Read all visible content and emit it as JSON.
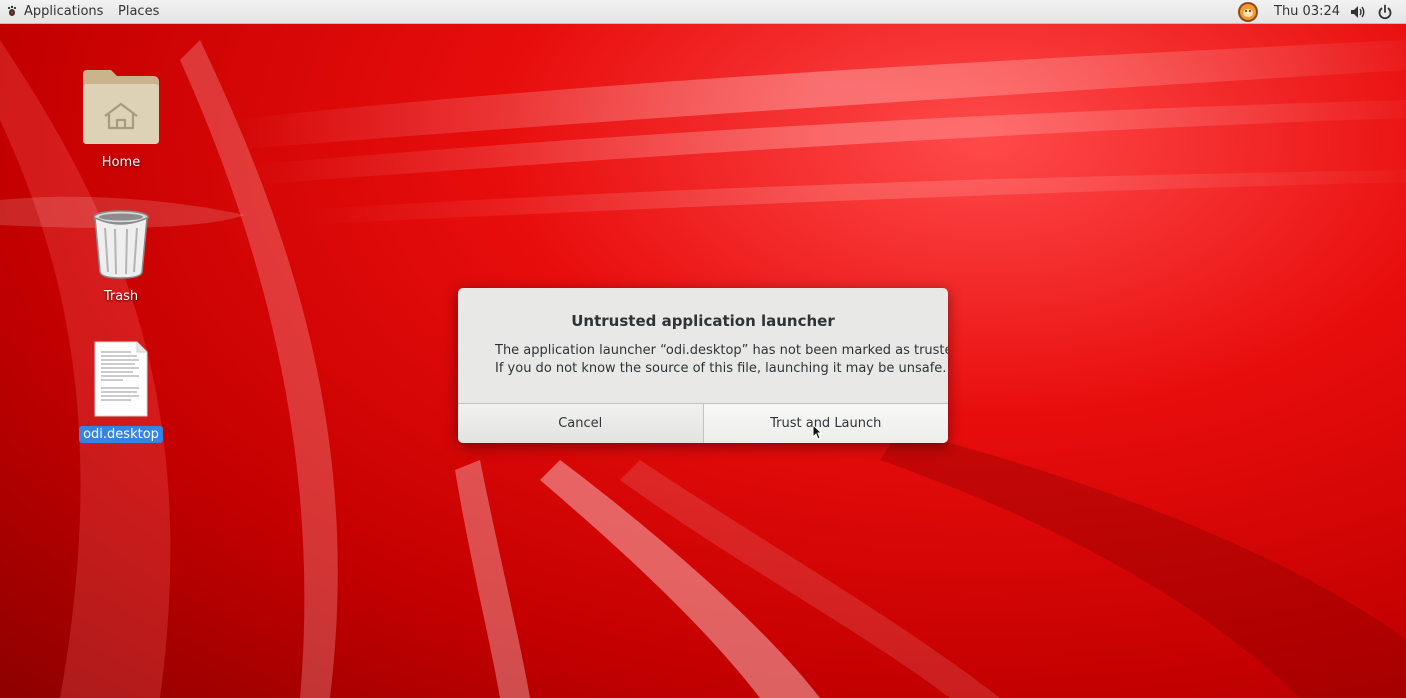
{
  "topbar": {
    "applications_label": "Applications",
    "places_label": "Places",
    "clock": "Thu 03:24",
    "icons": [
      "foot-icon",
      "user-avatar-icon",
      "volume-icon",
      "power-icon"
    ]
  },
  "desktop": {
    "icons": [
      {
        "label": "Home",
        "icon": "home-folder-icon"
      },
      {
        "label": "Trash",
        "icon": "trash-icon"
      },
      {
        "label": "odi.desktop",
        "icon": "text-file-icon",
        "selected": true
      }
    ]
  },
  "dialog": {
    "title": "Untrusted application launcher",
    "message_line1": "The application launcher “odi.desktop” has not been marked as trusted.",
    "message_line2": "If you do not know the source of this file, launching it may be unsafe.",
    "cancel_label": "Cancel",
    "trust_label": "Trust and Launch"
  },
  "colors": {
    "wallpaper_red": "#e80d0d",
    "selection_blue": "#3584e4",
    "dialog_bg": "#e8e8e7"
  }
}
